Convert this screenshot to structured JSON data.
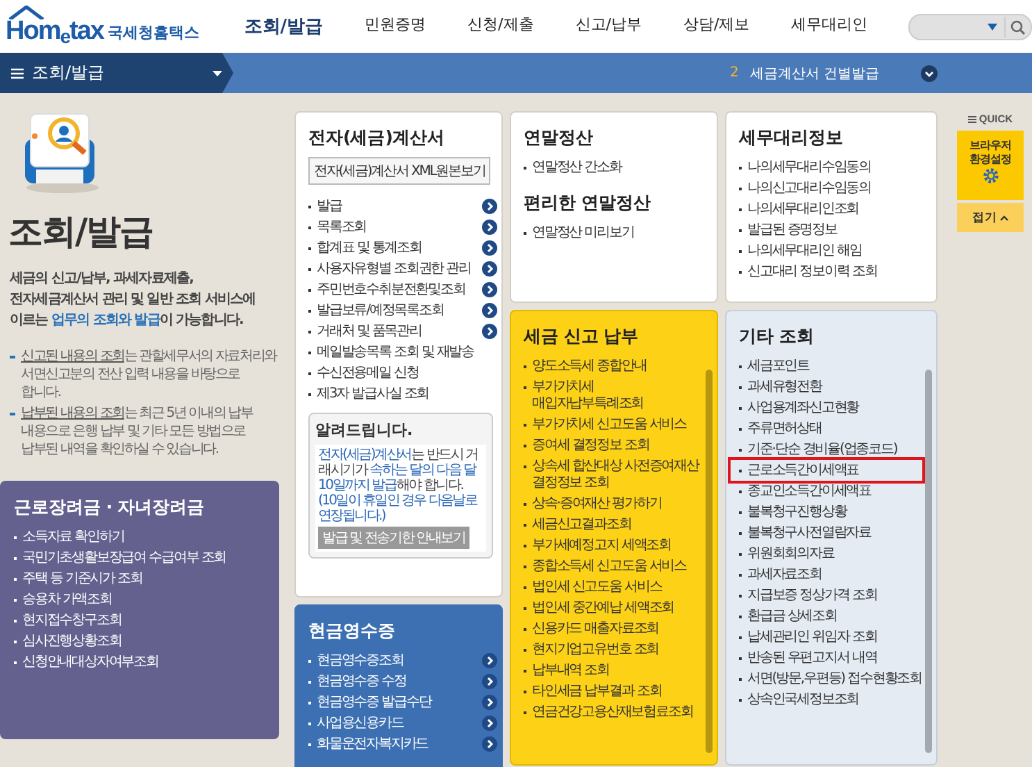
{
  "header": {
    "logo": {
      "home": "Hom",
      "e": "e",
      "tax": "tax",
      "org": "국세청홈택스"
    },
    "nav": [
      {
        "label": "조회/발급",
        "selected": true
      },
      {
        "label": "민원증명",
        "selected": false
      },
      {
        "label": "신청/제출",
        "selected": false
      },
      {
        "label": "신고/납부",
        "selected": false
      },
      {
        "label": "상담/제보",
        "selected": false
      },
      {
        "label": "세무대리인",
        "selected": false
      }
    ]
  },
  "menu_bar": {
    "title": "조회/발급",
    "notice_number": "2",
    "notice_text": "세금계산서 건별발급"
  },
  "intro": {
    "title": "조회/발급",
    "text": "세금의 신고/납부, 과세자료제출, 전자세금계산서 관리 및 일반 조회 서비스에 이르는 **업무의 조회와 발급**이 가능합니다.",
    "notes": [
      "**신고된 내용의 조회**는 관할세무서의 자료처리와 서면신고분의 전산 입력 내용을 바탕으로 합니다.",
      "**납부된 내용의 조회**는 최근 5년 이내의 납부 내용으로 은행 납부 및 기타 모든 방법으로 납부된 내역을 확인하실 수 있습니다."
    ]
  },
  "columns": [
    [
      {
        "kind": "white",
        "sections": [
          {
            "title": "전자(세금)계산서",
            "button": "전자(세금)계산서 XML원본보기",
            "items": [
              {
                "label": "발급",
                "arrow": true,
                "highlighted": false
              },
              {
                "label": "목록조회",
                "arrow": true,
                "highlighted": false
              },
              {
                "label": "합계표 및 통계조회",
                "arrow": true,
                "highlighted": false
              },
              {
                "label": "사용자유형별 조회권한 관리",
                "arrow": true,
                "highlighted": false
              },
              {
                "label": "주민번호수취분전환및조회",
                "arrow": true,
                "highlighted": false
              },
              {
                "label": "발급보류/예정목록조회",
                "arrow": true,
                "highlighted": false
              },
              {
                "label": "거래처 및 품목관리",
                "arrow": true,
                "highlighted": false
              },
              {
                "label": "메일발송목록 조회 및 재발송",
                "arrow": false,
                "highlighted": false
              },
              {
                "label": "수신전용메일 신청",
                "arrow": false,
                "highlighted": false
              },
              {
                "label": "제3자 발급사실 조회",
                "arrow": false,
                "highlighted": false
              }
            ]
          }
        ],
        "notice": {
          "title": "알려드립니다.",
          "text": "**전자(세금)계산서**는 반드시 거래시기가 **속하는 달의 다음 달 10일까지 발급**해야 합니다.",
          "note": "(10일이 휴일인 경우 다음날로 연장됩니다.)",
          "button": "발급 및 전송기한 안내보기"
        }
      },
      {
        "kind": "blue",
        "sections": [
          {
            "title": "현금영수증",
            "items": [
              {
                "label": "현금영수증조회",
                "arrow": true,
                "highlighted": false
              },
              {
                "label": "현금영수증 수정",
                "arrow": true,
                "highlighted": false
              },
              {
                "label": "현금영수증 발급수단",
                "arrow": true,
                "highlighted": false
              },
              {
                "label": "사업용신용카드",
                "arrow": true,
                "highlighted": false
              },
              {
                "label": "화물운전자복지카드",
                "arrow": true,
                "highlighted": false
              }
            ]
          }
        ]
      }
    ],
    [
      {
        "kind": "white",
        "sections": [
          {
            "title": "연말정산",
            "items": [
              {
                "label": "연말정산 간소화",
                "arrow": false,
                "highlighted": false
              }
            ]
          },
          {
            "title": "편리한 연말정산",
            "items": [
              {
                "label": "연말정산 미리보기",
                "arrow": false,
                "highlighted": false
              }
            ]
          }
        ]
      },
      {
        "kind": "yellow",
        "scrollable": true,
        "sections": [
          {
            "title": "세금 신고 납부",
            "items": [
              {
                "label": "양도소득세 종합안내",
                "arrow": false,
                "highlighted": false
              },
              {
                "label": "부가가치세 매입자납부특례조회",
                "arrow": false,
                "highlighted": false
              },
              {
                "label": "부가가치세 신고도움 서비스",
                "arrow": false,
                "highlighted": false
              },
              {
                "label": "증여세 결정정보 조회",
                "arrow": false,
                "highlighted": false
              },
              {
                "label": "상속세 합산대상 사전증여재산 결정정보 조회",
                "arrow": false,
                "highlighted": false
              },
              {
                "label": "상속·증여재산 평가하기",
                "arrow": false,
                "highlighted": false
              },
              {
                "label": "세금신고결과조회",
                "arrow": false,
                "highlighted": false
              },
              {
                "label": "부가세예정고지 세액조회",
                "arrow": false,
                "highlighted": false
              },
              {
                "label": "종합소득세 신고도움 서비스",
                "arrow": false,
                "highlighted": false
              },
              {
                "label": "법인세 신고도움 서비스",
                "arrow": false,
                "highlighted": false
              },
              {
                "label": "법인세 중간예납 세액조회",
                "arrow": false,
                "highlighted": false
              },
              {
                "label": "신용카드 매출자료조회",
                "arrow": false,
                "highlighted": false
              },
              {
                "label": "현지기업고유번호 조회",
                "arrow": false,
                "highlighted": false
              },
              {
                "label": "납부내역 조회",
                "arrow": false,
                "highlighted": false
              },
              {
                "label": "타인세금 납부결과 조회",
                "arrow": false,
                "highlighted": false
              },
              {
                "label": "연금건강고용산재보험료조회",
                "arrow": false,
                "highlighted": false
              }
            ]
          }
        ]
      }
    ],
    [
      {
        "kind": "white",
        "sections": [
          {
            "title": "세무대리정보",
            "items": [
              {
                "label": "나의세무대리수임동의",
                "arrow": false,
                "highlighted": false
              },
              {
                "label": "나의신고대리수임동의",
                "arrow": false,
                "highlighted": false
              },
              {
                "label": "나의세무대리인조회",
                "arrow": false,
                "highlighted": false
              },
              {
                "label": "발급된 증명정보",
                "arrow": false,
                "highlighted": false
              },
              {
                "label": "나의세무대리인 해임",
                "arrow": false,
                "highlighted": false
              },
              {
                "label": "신고대리 정보이력 조회",
                "arrow": false,
                "highlighted": false
              }
            ]
          }
        ]
      },
      {
        "kind": "pale",
        "scrollable": true,
        "sections": [
          {
            "title": "기타 조회",
            "items": [
              {
                "label": "세금포인트",
                "arrow": false,
                "highlighted": false
              },
              {
                "label": "과세유형전환",
                "arrow": false,
                "highlighted": false
              },
              {
                "label": "사업용계좌신고현황",
                "arrow": false,
                "highlighted": false
              },
              {
                "label": "주류면허상태",
                "arrow": false,
                "highlighted": false
              },
              {
                "label": "기준·단순 경비율(업종코드)",
                "arrow": false,
                "highlighted": false
              },
              {
                "label": "근로소득간이세액표",
                "arrow": false,
                "highlighted": true
              },
              {
                "label": "종교인소득간이세액표",
                "arrow": false,
                "highlighted": false
              },
              {
                "label": "불복청구진행상황",
                "arrow": false,
                "highlighted": false
              },
              {
                "label": "불복청구사전열람자료",
                "arrow": false,
                "highlighted": false
              },
              {
                "label": "위원회회의자료",
                "arrow": false,
                "highlighted": false
              },
              {
                "label": "과세자료조회",
                "arrow": false,
                "highlighted": false
              },
              {
                "label": "지급보증 정상가격 조회",
                "arrow": false,
                "highlighted": false
              },
              {
                "label": "환급금 상세조회",
                "arrow": false,
                "highlighted": false
              },
              {
                "label": "납세관리인 위임자 조회",
                "arrow": false,
                "highlighted": false
              },
              {
                "label": "반송된 우편고지서 내역",
                "arrow": false,
                "highlighted": false
              },
              {
                "label": "서면(방문,우편등) 접수현황조회",
                "arrow": false,
                "highlighted": false
              },
              {
                "label": "상속인국세정보조회",
                "arrow": false,
                "highlighted": false
              }
            ]
          }
        ]
      }
    ]
  ],
  "side_card": {
    "kind": "purple",
    "sections": [
      {
        "title": "근로장려금 · 자녀장려금",
        "items": [
          {
            "label": "소득자료 확인하기",
            "arrow": false,
            "highlighted": false
          },
          {
            "label": "국민기초생활보장급여 수급여부 조회",
            "arrow": false,
            "highlighted": false
          },
          {
            "label": "주택 등 기준시가 조회",
            "arrow": false,
            "highlighted": false
          },
          {
            "label": "승용차 가액조회",
            "arrow": false,
            "highlighted": false
          },
          {
            "label": "현지접수창구조회",
            "arrow": false,
            "highlighted": false
          },
          {
            "label": "심사진행상황조회",
            "arrow": false,
            "highlighted": false
          },
          {
            "label": "신청안내대상자여부조회",
            "arrow": false,
            "highlighted": false
          }
        ]
      }
    ]
  },
  "quick": {
    "title": "QUICK",
    "settings": "브라우저 환경설정",
    "collapse": "접기"
  }
}
